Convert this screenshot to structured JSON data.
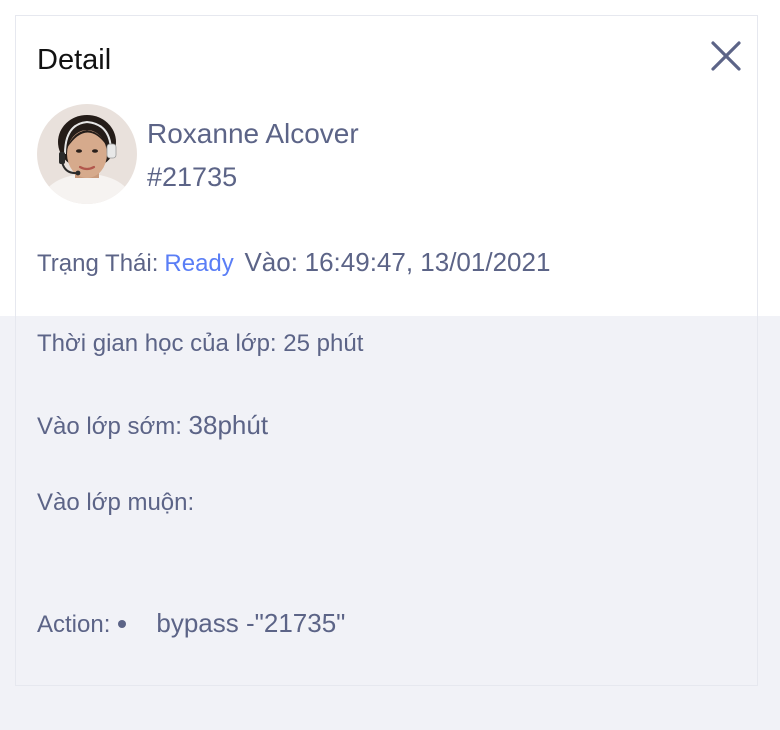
{
  "header": {
    "title": "Detail",
    "close_icon": "close-icon"
  },
  "user": {
    "name": "Roxanne Alcover",
    "id": "#21735",
    "avatar_icon": "avatar-photo"
  },
  "details": {
    "status_label": "Trạng Thái:",
    "status_value": "Ready",
    "entry_label": "Vào:",
    "entry_value": "16:49:47, 13/01/2021",
    "class_time_label": "Thời gian học của lớp:",
    "class_time_value": "25 phút",
    "early_label": "Vào lớp sớm:",
    "early_value": "38phút",
    "late_label": "Vào lớp muộn:",
    "late_value": "",
    "action_label": "Action:",
    "action_value": "bypass -\"21735\""
  },
  "colors": {
    "accent": "#5a7ef6",
    "text": "#5c6487",
    "panel_bg": "#f1f2f7"
  }
}
